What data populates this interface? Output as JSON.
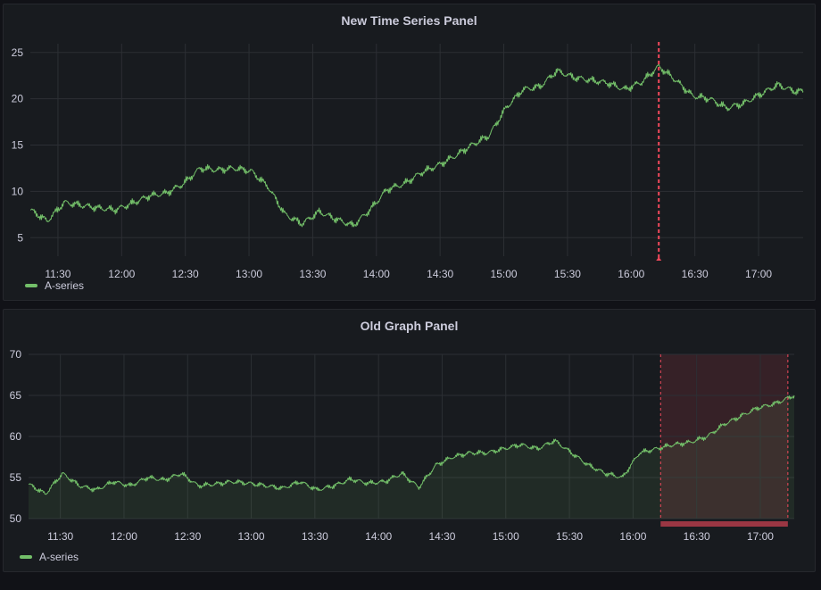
{
  "colors": {
    "series": "#73bf69",
    "grid": "#2c2f34",
    "annotation": "#f2495c",
    "region_fill": "rgba(242,73,92,0.14)"
  },
  "chart_data": [
    {
      "type": "line",
      "title": "New Time Series Panel",
      "x_ticks": [
        "11:30",
        "12:00",
        "12:30",
        "13:00",
        "13:30",
        "14:00",
        "14:30",
        "15:00",
        "15:30",
        "16:00",
        "16:30",
        "17:00"
      ],
      "y_ticks": [
        5,
        10,
        15,
        20,
        25
      ],
      "ylim": [
        3,
        27
      ],
      "xlim": [
        "11:17",
        "17:21"
      ],
      "grid": true,
      "annotation_time": "16:13",
      "legend": [
        "A-series"
      ],
      "series": [
        {
          "name": "A-series",
          "x": [
            "11:17",
            "11:25",
            "11:33",
            "11:41",
            "11:49",
            "11:57",
            "12:05",
            "12:13",
            "12:21",
            "12:29",
            "12:37",
            "12:45",
            "12:53",
            "13:01",
            "13:09",
            "13:17",
            "13:25",
            "13:33",
            "13:41",
            "13:49",
            "13:57",
            "14:05",
            "14:13",
            "14:21",
            "14:29",
            "14:37",
            "14:45",
            "14:53",
            "15:01",
            "15:09",
            "15:17",
            "15:25",
            "15:33",
            "15:41",
            "15:49",
            "15:57",
            "16:05",
            "16:13",
            "16:21",
            "16:29",
            "16:37",
            "16:45",
            "16:53",
            "17:01",
            "17:09",
            "17:17",
            "17:21"
          ],
          "values": [
            8,
            6.8,
            8.8,
            8.5,
            8.2,
            8,
            8.7,
            9.5,
            9.8,
            10.8,
            12.5,
            12.3,
            12.5,
            12.2,
            10.5,
            7.5,
            6.5,
            7.8,
            7,
            6.3,
            8,
            10.2,
            10.8,
            12,
            12.8,
            13.8,
            15,
            16,
            19,
            21,
            21.3,
            23,
            22.3,
            22,
            21.7,
            21,
            21.8,
            23.5,
            22,
            20.3,
            20,
            19,
            19.5,
            20.5,
            21.5,
            20.8,
            20.8
          ]
        }
      ]
    },
    {
      "type": "area",
      "title": "Old Graph Panel",
      "x_ticks": [
        "11:30",
        "12:00",
        "12:30",
        "13:00",
        "13:30",
        "14:00",
        "14:30",
        "15:00",
        "15:30",
        "16:00",
        "16:30",
        "17:00"
      ],
      "y_ticks": [
        50,
        55,
        60,
        65,
        70
      ],
      "ylim": [
        50,
        70
      ],
      "xlim": [
        "11:15",
        "17:16"
      ],
      "grid": true,
      "annotation_region": [
        "16:13",
        "17:13"
      ],
      "legend": [
        "A-series"
      ],
      "series": [
        {
          "name": "A-series",
          "x": [
            "11:15",
            "11:23",
            "11:31",
            "11:39",
            "11:47",
            "11:55",
            "12:03",
            "12:11",
            "12:19",
            "12:27",
            "12:35",
            "12:43",
            "12:51",
            "12:59",
            "13:07",
            "13:15",
            "13:23",
            "13:31",
            "13:39",
            "13:47",
            "13:55",
            "14:03",
            "14:11",
            "14:19",
            "14:27",
            "14:35",
            "14:43",
            "14:51",
            "14:59",
            "15:07",
            "15:15",
            "15:23",
            "15:31",
            "15:39",
            "15:47",
            "15:55",
            "16:03",
            "16:11",
            "16:19",
            "16:27",
            "16:35",
            "16:43",
            "16:51",
            "16:59",
            "17:07",
            "17:16"
          ],
          "values": [
            54.2,
            53,
            55.5,
            54,
            53.5,
            54.5,
            54,
            55,
            54.7,
            55.5,
            54,
            54.2,
            54.5,
            54.3,
            54,
            53.7,
            54.5,
            53.5,
            54,
            54.8,
            54.3,
            54.5,
            55.5,
            53.8,
            56.5,
            57.5,
            58,
            58,
            58.5,
            59,
            58.5,
            59.5,
            58,
            56.5,
            55.5,
            55,
            58,
            58.5,
            59,
            59.3,
            60,
            61.5,
            62.5,
            63.5,
            64,
            65
          ]
        }
      ]
    }
  ]
}
